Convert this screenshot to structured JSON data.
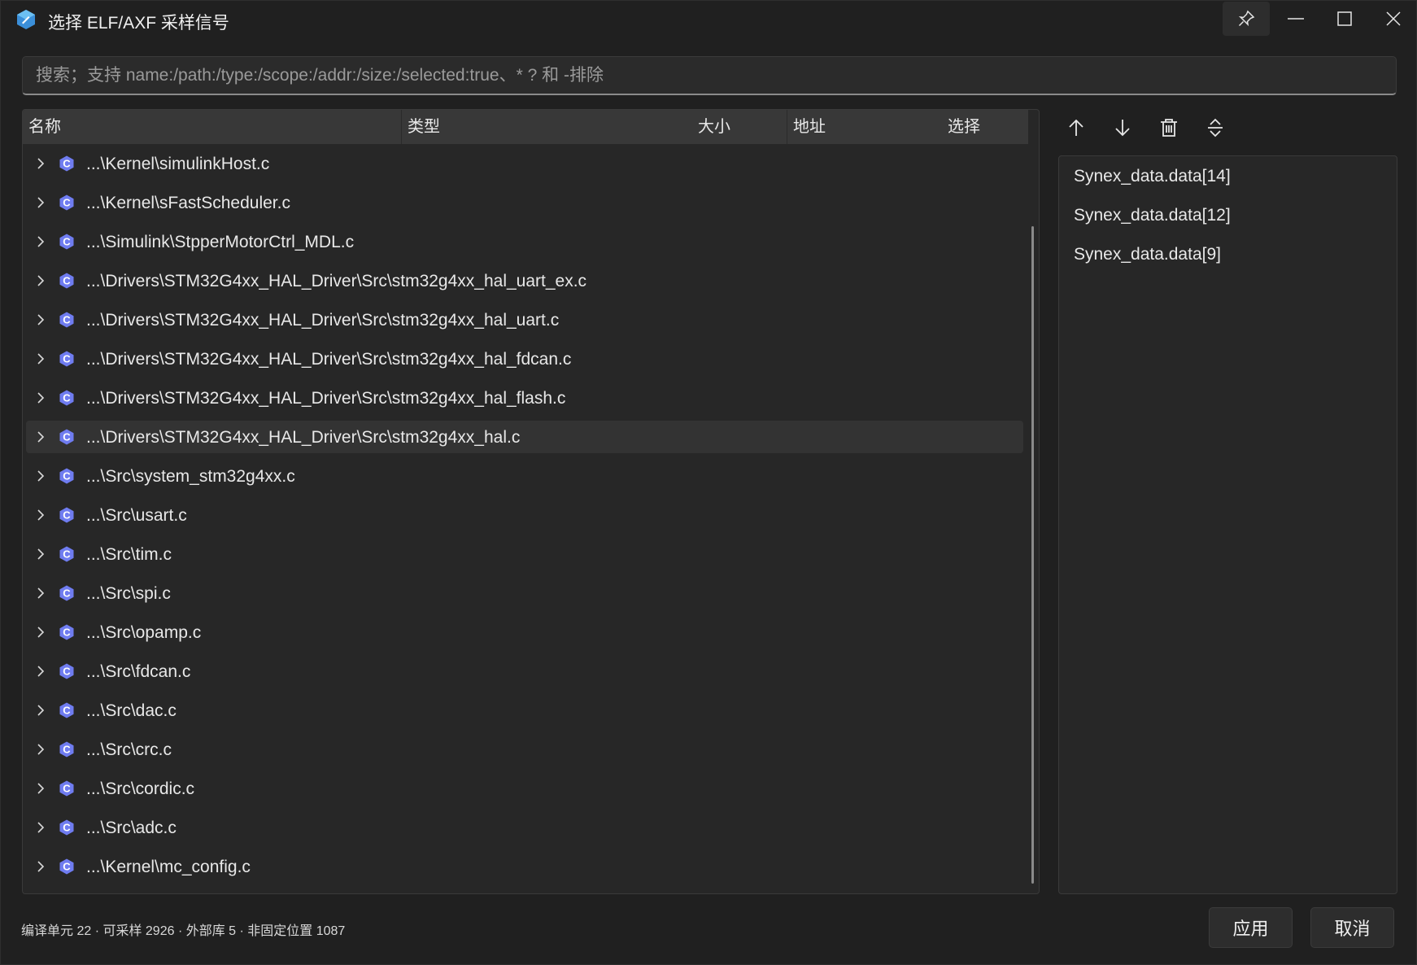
{
  "window": {
    "title": "选择 ELF/AXF 采样信号",
    "controls": [
      "pin",
      "minimize",
      "maximize",
      "close"
    ]
  },
  "search": {
    "placeholder": "搜索；支持 name:/path:/type:/scope:/addr:/size:/selected:true、* ? 和 -排除",
    "value": ""
  },
  "tree": {
    "columns": [
      "名称",
      "类型",
      "大小",
      "地址",
      "选择"
    ],
    "rows": [
      {
        "label": "...\\Kernel\\simulinkHost.c",
        "icon": "c-file-icon"
      },
      {
        "label": "...\\Kernel\\sFastScheduler.c",
        "icon": "c-file-icon"
      },
      {
        "label": "...\\Simulink\\StpperMotorCtrl_MDL.c",
        "icon": "c-file-icon"
      },
      {
        "label": "...\\Drivers\\STM32G4xx_HAL_Driver\\Src\\stm32g4xx_hal_uart_ex.c",
        "icon": "c-file-icon"
      },
      {
        "label": "...\\Drivers\\STM32G4xx_HAL_Driver\\Src\\stm32g4xx_hal_uart.c",
        "icon": "c-file-icon"
      },
      {
        "label": "...\\Drivers\\STM32G4xx_HAL_Driver\\Src\\stm32g4xx_hal_fdcan.c",
        "icon": "c-file-icon"
      },
      {
        "label": "...\\Drivers\\STM32G4xx_HAL_Driver\\Src\\stm32g4xx_hal_flash.c",
        "icon": "c-file-icon"
      },
      {
        "label": "...\\Drivers\\STM32G4xx_HAL_Driver\\Src\\stm32g4xx_hal.c",
        "icon": "c-file-icon",
        "selected": true
      },
      {
        "label": "...\\Src\\system_stm32g4xx.c",
        "icon": "c-file-icon"
      },
      {
        "label": "...\\Src\\usart.c",
        "icon": "c-file-icon"
      },
      {
        "label": "...\\Src\\tim.c",
        "icon": "c-file-icon"
      },
      {
        "label": "...\\Src\\spi.c",
        "icon": "c-file-icon"
      },
      {
        "label": "...\\Src\\opamp.c",
        "icon": "c-file-icon"
      },
      {
        "label": "...\\Src\\fdcan.c",
        "icon": "c-file-icon"
      },
      {
        "label": "...\\Src\\dac.c",
        "icon": "c-file-icon"
      },
      {
        "label": "...\\Src\\crc.c",
        "icon": "c-file-icon"
      },
      {
        "label": "...\\Src\\cordic.c",
        "icon": "c-file-icon"
      },
      {
        "label": "...\\Src\\adc.c",
        "icon": "c-file-icon"
      },
      {
        "label": "...\\Kernel\\mc_config.c",
        "icon": "c-file-icon"
      }
    ]
  },
  "toolbar": {
    "icons": [
      "arrow-up-icon",
      "arrow-down-icon",
      "trash-icon",
      "sort-icon"
    ]
  },
  "selected_signals": [
    "Synex_data.data[14]",
    "Synex_data.data[12]",
    "Synex_data.data[9]"
  ],
  "status": "编译单元 22 · 可采样 2926 · 外部库 5 · 非固定位置 1087",
  "buttons": {
    "apply": "应用",
    "cancel": "取消"
  },
  "colors": {
    "background": "#202020",
    "panel": "#272727",
    "header": "#383838",
    "c_icon": "#6f7cf0",
    "app_icon": "#4aa3e8"
  }
}
